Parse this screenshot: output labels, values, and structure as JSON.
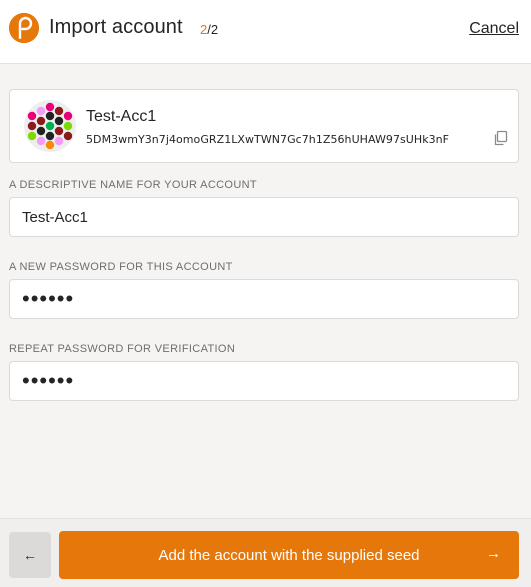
{
  "header": {
    "title": "Import account",
    "step_current": "2",
    "step_total": "/2",
    "cancel_label": "Cancel",
    "accent_color": "#e6770a"
  },
  "account": {
    "name": "Test-Acc1",
    "address": "5DM3wmY3n7j4omoGRZ1LXwTWN7Gc7h1Z56hUHAW97sUHk3nF",
    "copy_icon": "copy-icon"
  },
  "form": {
    "name_label": "A descriptive name for your account",
    "name_value": "Test-Acc1",
    "password_label": "A new password for this account",
    "password_value": "••••••",
    "repeat_label": "Repeat password for verification",
    "repeat_value": "••••••"
  },
  "footer": {
    "back_icon": "←",
    "submit_label": "Add the account with the supplied seed",
    "submit_icon": "→"
  }
}
